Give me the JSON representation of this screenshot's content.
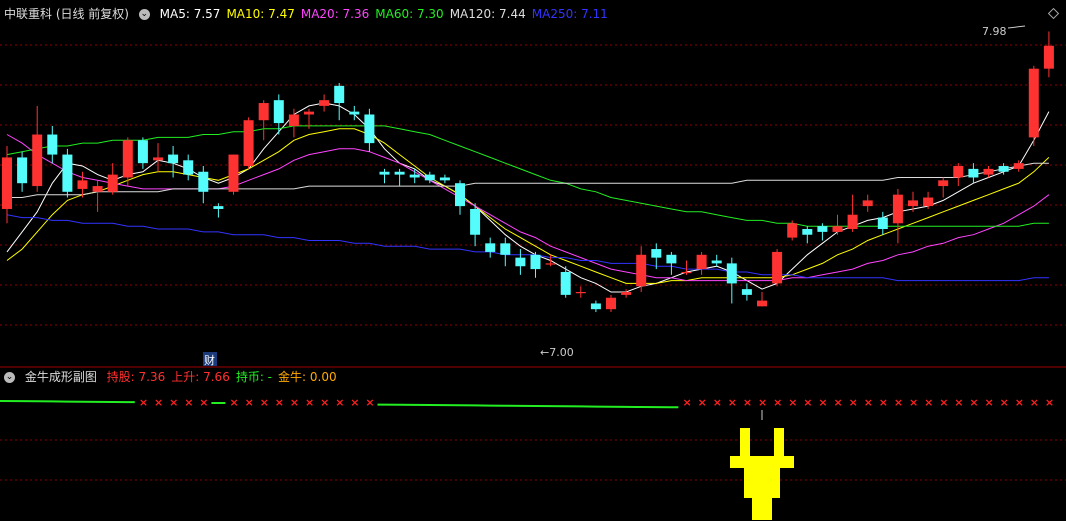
{
  "header": {
    "stock_title": "中联重科 (日线 前复权)",
    "ma_items": [
      {
        "label": "MA5: 7.57",
        "color": "#ffffff"
      },
      {
        "label": "MA10: 7.47",
        "color": "#ffff00"
      },
      {
        "label": "MA20: 7.36",
        "color": "#ff44ff"
      },
      {
        "label": "MA60: 7.30",
        "color": "#22ee22"
      },
      {
        "label": "MA120: 7.44",
        "color": "#dddddd"
      },
      {
        "label": "MA250: 7.11",
        "color": "#3333ff"
      }
    ]
  },
  "sub_header": {
    "indicator_title": "金牛成形副图",
    "items": [
      {
        "label": "持股: 7.36",
        "color": "#ff3030"
      },
      {
        "label": "上升: 7.66",
        "color": "#ff3030"
      },
      {
        "label": "持币: -",
        "color": "#22ee22"
      },
      {
        "label": "金牛: 0.00",
        "color": "#ffaa00"
      }
    ]
  },
  "annotations": {
    "high_label": "7.98",
    "low_label": "7.00",
    "cai_badge": "财"
  },
  "colors": {
    "up": "#ff3232",
    "down": "#54fcfc",
    "grid": "#8b0000",
    "hold": "#ff2020",
    "wait": "#22ee22",
    "bull": "#ffff00"
  },
  "chart_data": {
    "type": "candlestick",
    "ylim": [
      6.85,
      8.02
    ],
    "candles": [
      [
        7.36,
        7.54,
        7.31,
        7.58
      ],
      [
        7.54,
        7.45,
        7.42,
        7.56
      ],
      [
        7.44,
        7.62,
        7.42,
        7.72
      ],
      [
        7.62,
        7.55,
        7.52,
        7.65
      ],
      [
        7.55,
        7.42,
        7.4,
        7.57
      ],
      [
        7.43,
        7.46,
        7.4,
        7.49
      ],
      [
        7.42,
        7.44,
        7.35,
        7.46
      ],
      [
        7.42,
        7.48,
        7.41,
        7.52
      ],
      [
        7.47,
        7.6,
        7.44,
        7.61
      ],
      [
        7.6,
        7.52,
        7.5,
        7.61
      ],
      [
        7.53,
        7.54,
        7.49,
        7.59
      ],
      [
        7.55,
        7.52,
        7.47,
        7.58
      ],
      [
        7.53,
        7.48,
        7.46,
        7.55
      ],
      [
        7.49,
        7.42,
        7.38,
        7.51
      ],
      [
        7.37,
        7.36,
        7.33,
        7.38
      ],
      [
        7.42,
        7.55,
        7.41,
        7.55
      ],
      [
        7.51,
        7.67,
        7.5,
        7.68
      ],
      [
        7.67,
        7.73,
        7.6,
        7.74
      ],
      [
        7.74,
        7.66,
        7.62,
        7.76
      ],
      [
        7.65,
        7.69,
        7.61,
        7.71
      ],
      [
        7.69,
        7.7,
        7.64,
        7.71
      ],
      [
        7.72,
        7.74,
        7.7,
        7.76
      ],
      [
        7.79,
        7.73,
        7.67,
        7.8
      ],
      [
        7.7,
        7.69,
        7.67,
        7.72
      ],
      [
        7.69,
        7.59,
        7.56,
        7.71
      ],
      [
        7.49,
        7.48,
        7.45,
        7.5
      ],
      [
        7.49,
        7.48,
        7.44,
        7.5
      ],
      [
        7.48,
        7.47,
        7.45,
        7.5
      ],
      [
        7.48,
        7.46,
        7.45,
        7.49
      ],
      [
        7.47,
        7.46,
        7.45,
        7.48
      ],
      [
        7.45,
        7.37,
        7.34,
        7.46
      ],
      [
        7.36,
        7.27,
        7.23,
        7.38
      ],
      [
        7.24,
        7.21,
        7.19,
        7.26
      ],
      [
        7.24,
        7.2,
        7.16,
        7.26
      ],
      [
        7.19,
        7.16,
        7.13,
        7.22
      ],
      [
        7.2,
        7.15,
        7.12,
        7.21
      ],
      [
        7.17,
        7.17,
        7.16,
        7.2
      ],
      [
        7.14,
        7.06,
        7.05,
        7.16
      ],
      [
        7.07,
        7.07,
        7.05,
        7.09
      ],
      [
        7.03,
        7.01,
        7.0,
        7.04
      ],
      [
        7.01,
        7.05,
        7.0,
        7.06
      ],
      [
        7.06,
        7.07,
        7.05,
        7.08
      ],
      [
        7.09,
        7.2,
        7.07,
        7.23
      ],
      [
        7.22,
        7.19,
        7.15,
        7.24
      ],
      [
        7.2,
        7.17,
        7.13,
        7.21
      ],
      [
        7.14,
        7.14,
        7.13,
        7.18
      ],
      [
        7.15,
        7.2,
        7.13,
        7.21
      ],
      [
        7.18,
        7.17,
        7.16,
        7.2
      ],
      [
        7.17,
        7.1,
        7.03,
        7.19
      ],
      [
        7.08,
        7.06,
        7.04,
        7.1
      ],
      [
        7.02,
        7.04,
        7.02,
        7.07
      ],
      [
        7.1,
        7.21,
        7.09,
        7.22
      ],
      [
        7.26,
        7.31,
        7.25,
        7.32
      ],
      [
        7.29,
        7.27,
        7.24,
        7.3
      ],
      [
        7.3,
        7.28,
        7.25,
        7.31
      ],
      [
        7.28,
        7.3,
        7.27,
        7.34
      ],
      [
        7.29,
        7.34,
        7.28,
        7.41
      ],
      [
        7.37,
        7.39,
        7.35,
        7.41
      ],
      [
        7.33,
        7.29,
        7.27,
        7.35
      ],
      [
        7.31,
        7.41,
        7.24,
        7.43
      ],
      [
        7.37,
        7.39,
        7.35,
        7.42
      ],
      [
        7.37,
        7.4,
        7.36,
        7.42
      ],
      [
        7.44,
        7.46,
        7.4,
        7.47
      ],
      [
        7.47,
        7.51,
        7.44,
        7.52
      ],
      [
        7.5,
        7.47,
        7.45,
        7.52
      ],
      [
        7.48,
        7.5,
        7.47,
        7.51
      ],
      [
        7.51,
        7.49,
        7.48,
        7.52
      ],
      [
        7.5,
        7.52,
        7.49,
        7.53
      ],
      [
        7.61,
        7.85,
        7.58,
        7.86
      ],
      [
        7.85,
        7.93,
        7.82,
        7.98
      ]
    ],
    "series": [
      {
        "name": "MA5",
        "color": "#ffffff",
        "values": [
          7.21,
          7.28,
          7.35,
          7.45,
          7.52,
          7.51,
          7.48,
          7.46,
          7.48,
          7.49,
          7.53,
          7.52,
          7.5,
          7.47,
          7.45,
          7.47,
          7.5,
          7.57,
          7.63,
          7.69,
          7.72,
          7.73,
          7.72,
          7.69,
          7.64,
          7.57,
          7.52,
          7.5,
          7.46,
          7.44,
          7.41,
          7.37,
          7.32,
          7.27,
          7.23,
          7.2,
          7.18,
          7.15,
          7.12,
          7.1,
          7.07,
          7.07,
          7.09,
          7.1,
          7.12,
          7.14,
          7.15,
          7.16,
          7.14,
          7.11,
          7.08,
          7.1,
          7.15,
          7.2,
          7.24,
          7.28,
          7.3,
          7.32,
          7.33,
          7.35,
          7.36,
          7.37,
          7.39,
          7.42,
          7.45,
          7.47,
          7.49,
          7.51,
          7.6,
          7.7
        ]
      },
      {
        "name": "MA10",
        "color": "#ffff00",
        "values": [
          7.18,
          7.22,
          7.28,
          7.34,
          7.39,
          7.41,
          7.42,
          7.44,
          7.46,
          7.48,
          7.49,
          7.49,
          7.48,
          7.47,
          7.46,
          7.48,
          7.5,
          7.53,
          7.56,
          7.6,
          7.62,
          7.63,
          7.64,
          7.64,
          7.62,
          7.59,
          7.55,
          7.51,
          7.47,
          7.44,
          7.41,
          7.37,
          7.33,
          7.29,
          7.26,
          7.23,
          7.2,
          7.18,
          7.16,
          7.14,
          7.12,
          7.1,
          7.1,
          7.1,
          7.11,
          7.11,
          7.12,
          7.12,
          7.12,
          7.12,
          7.12,
          7.12,
          7.13,
          7.15,
          7.17,
          7.2,
          7.22,
          7.25,
          7.27,
          7.29,
          7.31,
          7.33,
          7.35,
          7.37,
          7.39,
          7.41,
          7.43,
          7.45,
          7.49,
          7.54
        ]
      },
      {
        "name": "MA20",
        "color": "#ff44ff",
        "values": [
          7.62,
          7.59,
          7.55,
          7.52,
          7.49,
          7.47,
          7.46,
          7.45,
          7.44,
          7.43,
          7.43,
          7.43,
          7.43,
          7.43,
          7.43,
          7.44,
          7.46,
          7.48,
          7.5,
          7.53,
          7.55,
          7.56,
          7.57,
          7.57,
          7.56,
          7.54,
          7.52,
          7.49,
          7.46,
          7.43,
          7.4,
          7.37,
          7.34,
          7.31,
          7.28,
          7.26,
          7.23,
          7.21,
          7.19,
          7.17,
          7.15,
          7.14,
          7.13,
          7.12,
          7.12,
          7.11,
          7.11,
          7.11,
          7.11,
          7.11,
          7.11,
          7.11,
          7.12,
          7.12,
          7.13,
          7.14,
          7.15,
          7.17,
          7.18,
          7.2,
          7.21,
          7.23,
          7.24,
          7.26,
          7.27,
          7.29,
          7.31,
          7.34,
          7.37,
          7.41
        ]
      },
      {
        "name": "MA60",
        "color": "#22ee22",
        "values": [
          7.55,
          7.56,
          7.57,
          7.58,
          7.58,
          7.59,
          7.59,
          7.6,
          7.6,
          7.6,
          7.61,
          7.61,
          7.61,
          7.62,
          7.62,
          7.63,
          7.63,
          7.64,
          7.64,
          7.65,
          7.65,
          7.65,
          7.65,
          7.65,
          7.65,
          7.65,
          7.64,
          7.63,
          7.62,
          7.6,
          7.58,
          7.56,
          7.54,
          7.52,
          7.5,
          7.48,
          7.46,
          7.45,
          7.43,
          7.42,
          7.4,
          7.39,
          7.38,
          7.37,
          7.36,
          7.35,
          7.35,
          7.34,
          7.33,
          7.32,
          7.32,
          7.31,
          7.31,
          7.3,
          7.3,
          7.3,
          7.3,
          7.3,
          7.3,
          7.3,
          7.3,
          7.3,
          7.3,
          7.3,
          7.3,
          7.3,
          7.3,
          7.3,
          7.31,
          7.31
        ]
      },
      {
        "name": "MA120",
        "color": "#dddddd",
        "values": [
          7.4,
          7.4,
          7.41,
          7.41,
          7.41,
          7.41,
          7.42,
          7.42,
          7.42,
          7.42,
          7.42,
          7.43,
          7.43,
          7.43,
          7.43,
          7.43,
          7.43,
          7.43,
          7.43,
          7.43,
          7.44,
          7.44,
          7.44,
          7.44,
          7.44,
          7.44,
          7.44,
          7.44,
          7.44,
          7.44,
          7.44,
          7.45,
          7.45,
          7.45,
          7.45,
          7.45,
          7.45,
          7.45,
          7.45,
          7.45,
          7.45,
          7.45,
          7.45,
          7.45,
          7.45,
          7.45,
          7.45,
          7.45,
          7.45,
          7.46,
          7.46,
          7.46,
          7.46,
          7.46,
          7.46,
          7.46,
          7.46,
          7.46,
          7.46,
          7.47,
          7.47,
          7.47,
          7.47,
          7.47,
          7.48,
          7.49,
          7.5,
          7.51,
          7.52,
          7.52
        ]
      },
      {
        "name": "MA250",
        "color": "#3333ff",
        "values": [
          7.34,
          7.33,
          7.33,
          7.32,
          7.32,
          7.31,
          7.31,
          7.31,
          7.3,
          7.3,
          7.29,
          7.29,
          7.29,
          7.28,
          7.28,
          7.27,
          7.27,
          7.27,
          7.26,
          7.26,
          7.25,
          7.25,
          7.25,
          7.24,
          7.24,
          7.23,
          7.23,
          7.23,
          7.22,
          7.22,
          7.22,
          7.21,
          7.21,
          7.2,
          7.2,
          7.2,
          7.19,
          7.19,
          7.18,
          7.18,
          7.17,
          7.17,
          7.17,
          7.16,
          7.16,
          7.15,
          7.15,
          7.15,
          7.14,
          7.14,
          7.13,
          7.13,
          7.13,
          7.12,
          7.12,
          7.12,
          7.12,
          7.12,
          7.12,
          7.11,
          7.11,
          7.11,
          7.11,
          7.11,
          7.11,
          7.11,
          7.11,
          7.11,
          7.12,
          7.12
        ]
      }
    ],
    "indicator": {
      "state": [
        "wait",
        "wait",
        "wait",
        "wait",
        "wait",
        "wait",
        "wait",
        "wait",
        "wait",
        "hold",
        "hold",
        "hold",
        "hold",
        "hold",
        "wait",
        "hold",
        "hold",
        "hold",
        "hold",
        "hold",
        "hold",
        "hold",
        "hold",
        "hold",
        "hold",
        "wait",
        "wait",
        "wait",
        "wait",
        "wait",
        "wait",
        "wait",
        "wait",
        "wait",
        "wait",
        "wait",
        "wait",
        "wait",
        "wait",
        "wait",
        "wait",
        "wait",
        "wait",
        "wait",
        "wait",
        "hold",
        "hold",
        "hold",
        "hold",
        "hold",
        "hold",
        "hold",
        "hold",
        "hold",
        "hold",
        "hold",
        "hold",
        "hold",
        "hold",
        "hold",
        "hold",
        "hold",
        "hold",
        "hold",
        "hold",
        "hold",
        "hold",
        "hold",
        "hold",
        "hold"
      ],
      "bull_signal_index": 50
    }
  }
}
